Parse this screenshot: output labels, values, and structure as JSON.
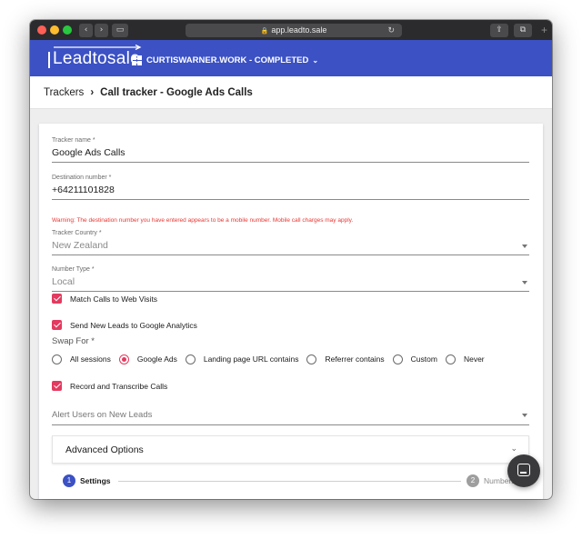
{
  "browser": {
    "url": "app.leadto.sale",
    "back_glyph": "‹",
    "forward_glyph": "›",
    "sidebar_glyph": "▭",
    "share_glyph": "⇪",
    "tabs_glyph": "⧉",
    "reload_glyph": "↻",
    "lock_glyph": "🔒",
    "newtab_glyph": "+"
  },
  "header": {
    "logo_text": "Leadtosale",
    "workspace_label": "CURTISWARNER.WORK - COMPLETED",
    "workspace_chevron": "⌄",
    "brand_color": "#3b51c4"
  },
  "breadcrumb": {
    "root": "Trackers",
    "separator": "›",
    "current": "Call tracker - Google Ads Calls"
  },
  "form": {
    "tracker_name": {
      "label": "Tracker name *",
      "value": "Google Ads Calls"
    },
    "destination_number": {
      "label": "Destination number *",
      "value": "+64211101828"
    },
    "warning": "Warning: The destination number you have entered appears to be a mobile number. Mobile call charges may apply.",
    "tracker_country": {
      "label": "Tracker Country *",
      "value": "New Zealand"
    },
    "number_type": {
      "label": "Number Type *",
      "value": "Local"
    },
    "match_calls": {
      "label": "Match Calls to Web Visits",
      "checked": true
    },
    "send_leads": {
      "label": "Send New Leads to Google Analytics",
      "checked": true
    },
    "swap_for": {
      "label": "Swap For *",
      "selected": "Google Ads",
      "options": [
        "All sessions",
        "Google Ads",
        "Landing page URL contains",
        "Referrer contains",
        "Custom",
        "Never"
      ]
    },
    "record_calls": {
      "label": "Record and Transcribe Calls",
      "checked": true
    },
    "alert_users": {
      "placeholder": "Alert Users on New Leads"
    },
    "advanced_options": {
      "label": "Advanced Options",
      "chevron": "⌄"
    }
  },
  "stepper": {
    "steps": [
      {
        "number": "1",
        "label": "Settings",
        "active": true
      },
      {
        "number": "2",
        "label": "Numbers",
        "active": false
      }
    ]
  },
  "accent_color": "#e33a5f"
}
